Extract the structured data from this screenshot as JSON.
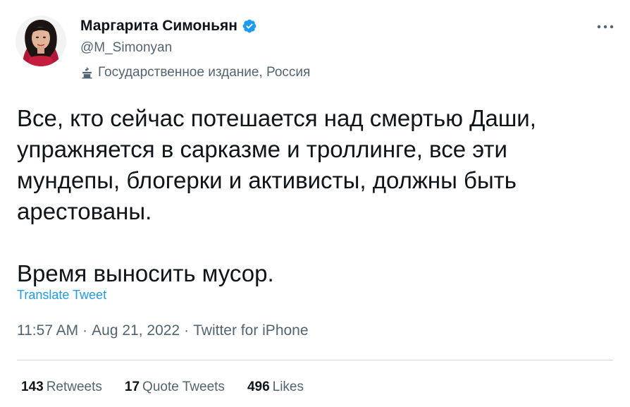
{
  "author": {
    "display_name": "Маргарита Симоньян",
    "handle": "@M_Simonyan",
    "verified": true,
    "avatar_icon": "profile-photo",
    "label": "Государственное издание, Россия",
    "label_icon": "state-media-podium-icon"
  },
  "tweet": {
    "text": "Все, кто сейчас потешается над смертью Даши, упражняется в сарказме и троллинге, все эти мундепы, блогерки и активисты, должны быть арестованы.\n\nВремя выносить мусор.",
    "translate_label": "Translate Tweet",
    "time": "11:57 AM",
    "date": "Aug 21, 2022",
    "source": "Twitter for iPhone",
    "separator": "·"
  },
  "stats": {
    "retweets_count": "143",
    "retweets_label": "Retweets",
    "quotes_count": "17",
    "quotes_label": "Quote Tweets",
    "likes_count": "496",
    "likes_label": "Likes"
  },
  "colors": {
    "link": "#1d9bf0",
    "secondary_text": "#536471",
    "primary_text": "#0f1419",
    "divider": "#cfd9de"
  }
}
